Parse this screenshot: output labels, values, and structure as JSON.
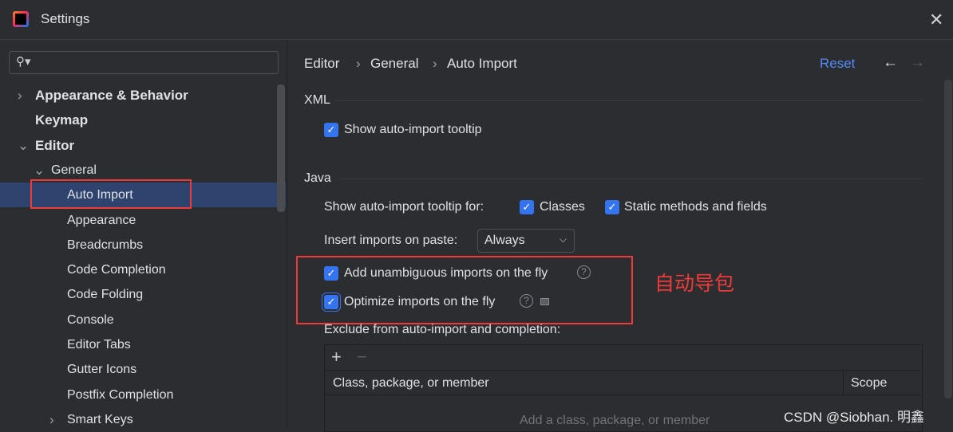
{
  "window": {
    "title": "Settings",
    "close_icon": "close-icon"
  },
  "sidebar": {
    "search_placeholder": "",
    "items": [
      {
        "label": "Appearance & Behavior",
        "level": 0,
        "expandable": true,
        "expanded": false
      },
      {
        "label": "Keymap",
        "level": 0
      },
      {
        "label": "Editor",
        "level": 0,
        "expandable": true,
        "expanded": true
      },
      {
        "label": "General",
        "level": 1,
        "expandable": true,
        "expanded": true
      },
      {
        "label": "Auto Import",
        "level": 2,
        "selected": true
      },
      {
        "label": "Appearance",
        "level": 2
      },
      {
        "label": "Breadcrumbs",
        "level": 2
      },
      {
        "label": "Code Completion",
        "level": 2
      },
      {
        "label": "Code Folding",
        "level": 2
      },
      {
        "label": "Console",
        "level": 2
      },
      {
        "label": "Editor Tabs",
        "level": 2
      },
      {
        "label": "Gutter Icons",
        "level": 2
      },
      {
        "label": "Postfix Completion",
        "level": 2
      },
      {
        "label": "Smart Keys",
        "level": 2,
        "expandable": true,
        "expanded": false
      }
    ]
  },
  "header": {
    "breadcrumb": [
      "Editor",
      "General",
      "Auto Import"
    ],
    "reset": "Reset"
  },
  "xml": {
    "title": "XML",
    "show_tooltip": {
      "label": "Show auto-import tooltip",
      "checked": true
    }
  },
  "java": {
    "title": "Java",
    "tooltip_for": "Show auto-import tooltip for:",
    "classes": {
      "label": "Classes",
      "checked": true
    },
    "static": {
      "label": "Static methods and fields",
      "checked": true
    },
    "insert_label": "Insert imports on paste:",
    "insert_value": "Always",
    "add_unambiguous": {
      "label": "Add unambiguous imports on the fly",
      "checked": true
    },
    "optimize": {
      "label": "Optimize imports on the fly",
      "checked": true
    },
    "exclude_label": "Exclude from auto-import and completion:",
    "table": {
      "columns": [
        "Class, package, or member",
        "Scope"
      ],
      "empty": "Add a class, package, or member"
    }
  },
  "annotation": {
    "text": "自动导包",
    "color": "#f03a3a"
  },
  "watermark": "CSDN @Siobhan. 明鑫",
  "colors": {
    "accent": "#3574f0",
    "selection": "#2e436e",
    "link": "#548af7"
  }
}
